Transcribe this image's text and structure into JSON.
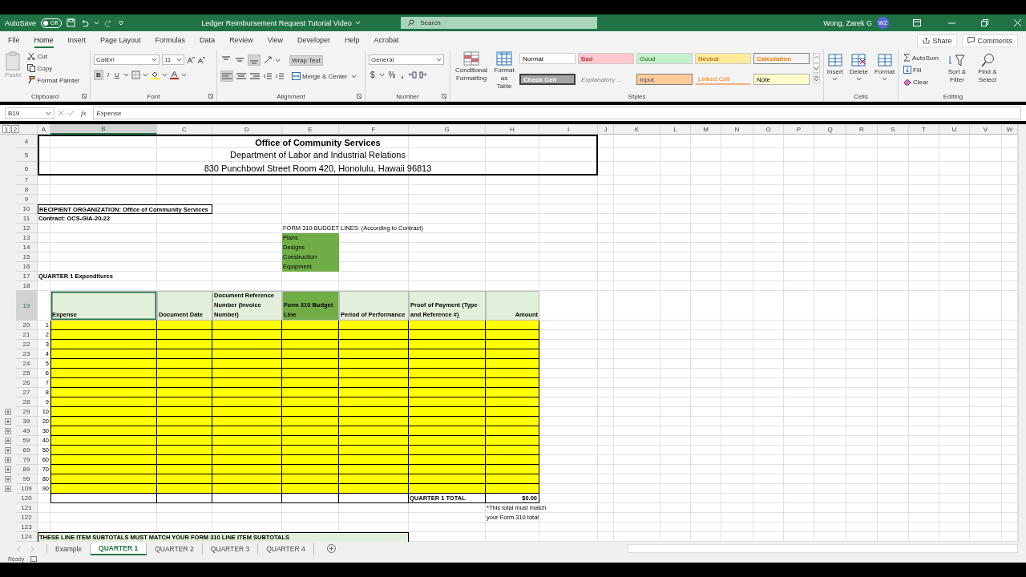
{
  "title_bar": {
    "autosave_label": "AutoSave",
    "autosave": {
      "on": false,
      "label": "Off"
    },
    "document_title": "Ledger Reimbursement Request Tutorial Video",
    "search": {
      "placeholder": "Search"
    },
    "user_name": "Wong, Zarek G",
    "avatar": "WZ"
  },
  "menu_tabs": [
    {
      "label": "File",
      "selected": false
    },
    {
      "label": "Home",
      "selected": true
    },
    {
      "label": "Insert",
      "selected": false
    },
    {
      "label": "Page Layout",
      "selected": false
    },
    {
      "label": "Formulas",
      "selected": false
    },
    {
      "label": "Data",
      "selected": false
    },
    {
      "label": "Review",
      "selected": false
    },
    {
      "label": "View",
      "selected": false
    },
    {
      "label": "Developer",
      "selected": false
    },
    {
      "label": "Help",
      "selected": false
    },
    {
      "label": "Acrobat",
      "selected": false
    }
  ],
  "share_button": "Share",
  "comments_button": "Comments",
  "ribbon": {
    "clipboard": {
      "label": "Clipboard",
      "paste": {
        "label": "Paste",
        "disabled": true
      },
      "cut": "Cut",
      "copy": "Copy",
      "format_painter": "Format Painter"
    },
    "font": {
      "label": "Font",
      "name": "Calibri",
      "size": "11",
      "bold": {
        "label": "B",
        "selected": true
      },
      "italic": {
        "label": "I",
        "selected": false
      },
      "underline": {
        "label": "U",
        "selected": false
      }
    },
    "alignment": {
      "label": "Alignment",
      "wrap_text": {
        "label": "Wrap Text",
        "selected": true
      },
      "merge": "Merge & Center"
    },
    "number": {
      "label": "Number",
      "format": "General",
      "currency": "$",
      "percent": "%",
      "comma": ","
    },
    "styles": {
      "label": "Styles",
      "conditional": "Conditional Formatting",
      "format_table": "Format as Table",
      "gallery": [
        {
          "label": "Normal",
          "color": "#ffffff",
          "kind": "normal"
        },
        {
          "label": "Bad",
          "color": "#ffc7ce",
          "kind": "bad"
        },
        {
          "label": "Good",
          "color": "#c6efce",
          "kind": "good"
        },
        {
          "label": "Neutral",
          "color": "#ffeb9c",
          "kind": "neutral"
        },
        {
          "label": "Calculation",
          "color": "#f2f2f2",
          "kind": "calculation"
        },
        {
          "label": "Check Cell",
          "color": "#a5a5a5",
          "kind": "check"
        },
        {
          "label": "Explanatory ...",
          "color": "#f3f3f3",
          "kind": "explanatory"
        },
        {
          "label": "Input",
          "color": "#ffcc99",
          "kind": "input"
        },
        {
          "label": "Linked Cell",
          "color": "#f3f3f3",
          "kind": "linked"
        },
        {
          "label": "Note",
          "color": "#ffffcc",
          "kind": "note"
        }
      ]
    },
    "cells": {
      "label": "Cells",
      "buttons": [
        "Insert",
        "Delete",
        "Format"
      ]
    },
    "editing": {
      "label": "Editing",
      "autosum": "AutoSum",
      "fill": "Fill",
      "clear": "Clear",
      "sort": "Sort & Filter",
      "find": "Find & Select"
    }
  },
  "formula_bar": {
    "name_box": "B19",
    "function_symbol": "fx",
    "formula": "Expense"
  },
  "sheet": {
    "outline_levels": [
      "1",
      "2"
    ],
    "columns": [
      {
        "label": "A",
        "selected": false
      },
      {
        "label": "B",
        "selected": true
      },
      {
        "label": "C",
        "selected": false
      },
      {
        "label": "D",
        "selected": false
      },
      {
        "label": "E",
        "selected": false
      },
      {
        "label": "F",
        "selected": false
      },
      {
        "label": "G",
        "selected": false
      },
      {
        "label": "H",
        "selected": false
      },
      {
        "label": "I",
        "selected": false
      },
      {
        "label": "J",
        "selected": false
      },
      {
        "label": "K",
        "selected": false
      },
      {
        "label": "L",
        "selected": false
      },
      {
        "label": "M",
        "selected": false
      },
      {
        "label": "N",
        "selected": false
      },
      {
        "label": "O",
        "selected": false
      },
      {
        "label": "P",
        "selected": false
      },
      {
        "label": "Q",
        "selected": false
      },
      {
        "label": "R",
        "selected": false
      },
      {
        "label": "S",
        "selected": false
      },
      {
        "label": "T",
        "selected": false
      },
      {
        "label": "U",
        "selected": false
      },
      {
        "label": "V",
        "selected": false
      },
      {
        "label": "W",
        "selected": false
      }
    ],
    "rows": [
      {
        "number": "4",
        "kind": "title_bold",
        "selected": false,
        "collapsed": false,
        "text": "Office of Community Services"
      },
      {
        "number": "5",
        "kind": "title",
        "selected": false,
        "collapsed": false,
        "text": "Department of Labor and Industrial Relations"
      },
      {
        "number": "6",
        "kind": "title",
        "selected": false,
        "collapsed": false,
        "text": "830 Punchbowl Street Room 420, Honolulu, Hawaii 96813"
      },
      {
        "number": "7",
        "kind": "blank",
        "selected": false,
        "collapsed": false
      },
      {
        "number": "8",
        "kind": "blank",
        "selected": false,
        "collapsed": false
      },
      {
        "number": "9",
        "kind": "blank",
        "selected": false,
        "collapsed": false
      },
      {
        "number": "10",
        "kind": "boxed_label",
        "selected": false,
        "collapsed": false,
        "text": "RECIPIENT ORGANIZATION: Office of Community Services"
      },
      {
        "number": "11",
        "kind": "label",
        "selected": false,
        "collapsed": false,
        "text": "Contract: OCS-GIA-20-22"
      },
      {
        "number": "12",
        "kind": "budget_heading",
        "selected": false,
        "collapsed": false,
        "text": "FORM 310 BUDGET LINES:  (According to Contract)"
      },
      {
        "number": "13",
        "kind": "budget_line",
        "selected": false,
        "collapsed": false,
        "text": "Plans"
      },
      {
        "number": "14",
        "kind": "budget_line",
        "selected": false,
        "collapsed": false,
        "text": "Designs"
      },
      {
        "number": "15",
        "kind": "budget_line",
        "selected": false,
        "collapsed": false,
        "text": "Construction"
      },
      {
        "number": "16",
        "kind": "budget_line",
        "selected": false,
        "collapsed": false,
        "text": "Equipment"
      },
      {
        "number": "17",
        "kind": "label",
        "selected": false,
        "collapsed": false,
        "text": "QUARTER 1 Expenditures"
      },
      {
        "number": "18",
        "kind": "blank",
        "selected": false,
        "collapsed": false
      },
      {
        "number": "19",
        "kind": "header",
        "selected": true,
        "collapsed": false,
        "columns": [
          {
            "text": "Expense",
            "selected": true,
            "color": "#e2efda"
          },
          {
            "text": "Document Date",
            "selected": false,
            "color": "#e2efda"
          },
          {
            "text": "Document Reference Number (Invoice Number)",
            "selected": false,
            "color": "#e2efda"
          },
          {
            "text": "Form 310 Budget Line",
            "selected": false,
            "color": "#70ad47"
          },
          {
            "text": "Period of Performance",
            "selected": false,
            "color": "#e2efda"
          },
          {
            "text": "Proof of Payment (Type and Reference #)",
            "selected": false,
            "color": "#e2efda"
          },
          {
            "text": "Amount",
            "selected": false,
            "color": "#e2efda"
          }
        ]
      },
      {
        "number": "20",
        "kind": "entry",
        "selected": false,
        "collapsed": false,
        "item": "1"
      },
      {
        "number": "21",
        "kind": "entry",
        "selected": false,
        "collapsed": false,
        "item": "2"
      },
      {
        "number": "22",
        "kind": "entry",
        "selected": false,
        "collapsed": false,
        "item": "3"
      },
      {
        "number": "23",
        "kind": "entry",
        "selected": false,
        "collapsed": false,
        "item": "4"
      },
      {
        "number": "24",
        "kind": "entry",
        "selected": false,
        "collapsed": false,
        "item": "5"
      },
      {
        "number": "25",
        "kind": "entry",
        "selected": false,
        "collapsed": false,
        "item": "6"
      },
      {
        "number": "26",
        "kind": "entry",
        "selected": false,
        "collapsed": false,
        "item": "7"
      },
      {
        "number": "27",
        "kind": "entry",
        "selected": false,
        "collapsed": false,
        "item": "8"
      },
      {
        "number": "28",
        "kind": "entry",
        "selected": false,
        "collapsed": false,
        "item": "9"
      },
      {
        "number": "29",
        "kind": "entry",
        "selected": false,
        "collapsed": true,
        "item": "10"
      },
      {
        "number": "39",
        "kind": "entry",
        "selected": false,
        "collapsed": true,
        "item": "20"
      },
      {
        "number": "49",
        "kind": "entry",
        "selected": false,
        "collapsed": true,
        "item": "30"
      },
      {
        "number": "59",
        "kind": "entry",
        "selected": false,
        "collapsed": true,
        "item": "40"
      },
      {
        "number": "69",
        "kind": "entry",
        "selected": false,
        "collapsed": true,
        "item": "50"
      },
      {
        "number": "79",
        "kind": "entry",
        "selected": false,
        "collapsed": true,
        "item": "60"
      },
      {
        "number": "89",
        "kind": "entry",
        "selected": false,
        "collapsed": true,
        "item": "70"
      },
      {
        "number": "99",
        "kind": "entry",
        "selected": false,
        "collapsed": true,
        "item": "80"
      },
      {
        "number": "109",
        "kind": "entry",
        "selected": false,
        "collapsed": true,
        "item": "90"
      },
      {
        "number": "120",
        "kind": "total",
        "selected": false,
        "collapsed": false,
        "label": "QUARTER 1 TOTAL",
        "value": "$0.00"
      },
      {
        "number": "121",
        "kind": "note",
        "selected": false,
        "collapsed": false,
        "text": "*This total must match"
      },
      {
        "number": "122",
        "kind": "note",
        "selected": false,
        "collapsed": false,
        "text": "your Form 310 total"
      },
      {
        "number": "123",
        "kind": "blank",
        "selected": false,
        "collapsed": false
      },
      {
        "number": "124",
        "kind": "banner",
        "selected": false,
        "collapsed": false,
        "text": "THESE LINE ITEM SUBTOTALS MUST MATCH YOUR FORM 310 LINE ITEM SUBTOTALS"
      }
    ]
  },
  "sheet_tabs": [
    {
      "label": "Example",
      "selected": false
    },
    {
      "label": "QUARTER 1",
      "selected": true
    },
    {
      "label": "QUARTER 2",
      "selected": false
    },
    {
      "label": "QUARTER 3",
      "selected": false
    },
    {
      "label": "QUARTER 4",
      "selected": false
    }
  ],
  "status_bar": {
    "status": "Ready"
  }
}
